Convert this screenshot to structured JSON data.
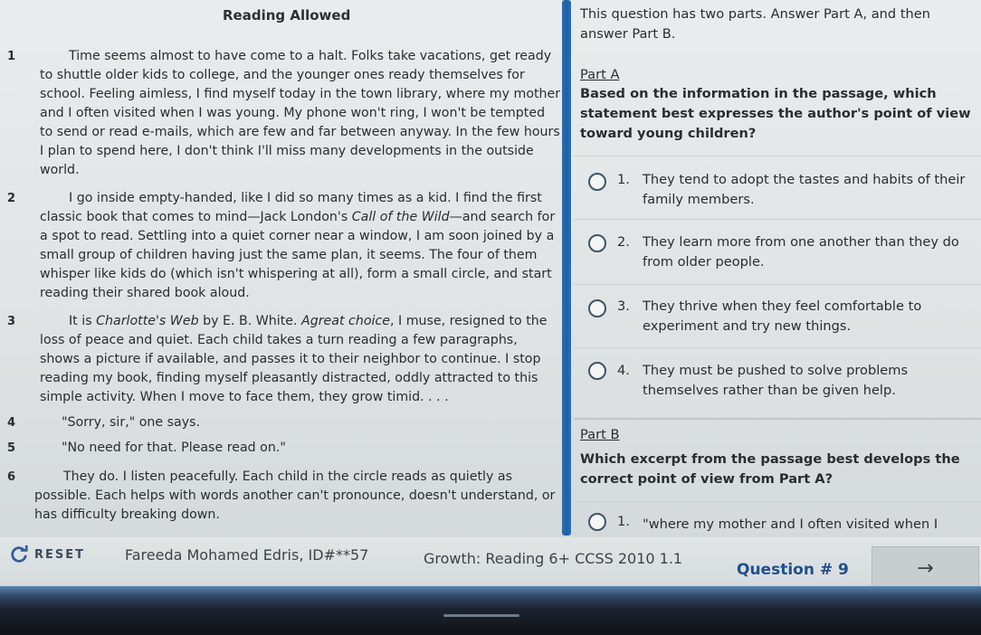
{
  "passage": {
    "title": "Reading Allowed",
    "paragraphs": [
      {
        "num": "1",
        "text": "Time seems almost to have come to a halt. Folks take vacations, get ready to shuttle older kids to college, and the younger ones ready themselves for school. Feeling aimless, I find myself today in the town library, where my mother and I often visited when I was young. My phone won't ring, I won't be tempted to send or read e-mails, which are few and far between anyway. In the few hours I plan to spend here, I don't think I'll miss many developments in the outside world."
      },
      {
        "num": "2",
        "text_a": "I go inside empty-handed, like I did so many times as a kid. I find the first classic book that comes to mind—Jack London's ",
        "em": "Call of the Wild",
        "text_b": "—and search for a spot to read. Settling into a quiet corner near a window, I am soon joined by a small group of children having just the same plan, it seems. The four of them whisper like kids do (which isn't whispering at all), form a small circle, and start reading their shared book aloud."
      },
      {
        "num": "3",
        "text_a": "It is ",
        "em": "Charlotte's Web",
        "text_b": " by E. B. White. ",
        "em2": "Agreat choice",
        "text_c": ", I muse, resigned to the loss of peace and quiet. Each child takes a turn reading a few paragraphs, shows a picture if available, and passes it to their neighbor to continue. I stop reading my book, finding myself pleasantly distracted, oddly attracted to this simple activity. When I move to face them, they grow timid. . . ."
      },
      {
        "num": "4",
        "text": "\"Sorry, sir,\" one says."
      },
      {
        "num": "5",
        "text": "\"No need for that. Please read on.\""
      },
      {
        "num": "6",
        "text": "They do. I listen peacefully. Each child in the circle reads as quietly as possible. Each helps with words another can't pronounce, doesn't understand, or has difficulty breaking down."
      }
    ]
  },
  "question": {
    "intro": "This question has two parts. Answer Part A, and then answer Part B.",
    "part_a": {
      "label": "Part A",
      "prompt": "Based on the information in the passage, which statement best expresses the author's point of view toward young children?",
      "options": [
        {
          "num": "1.",
          "text": "They tend to adopt the tastes and habits of their family members."
        },
        {
          "num": "2.",
          "text": "They learn more from one another than they do from older people."
        },
        {
          "num": "3.",
          "text": "They thrive when they feel comfortable to experiment and try new things."
        },
        {
          "num": "4.",
          "text": "They must be pushed to solve problems themselves rather than be given help."
        }
      ]
    },
    "part_b": {
      "label": "Part B",
      "prompt": "Which excerpt from the passage best develops the correct point of view from Part A?",
      "options": [
        {
          "num": "1.",
          "text": "\"where my mother and I often visited when I"
        }
      ]
    }
  },
  "status": {
    "reset_label": "RESET",
    "student": "Fareeda Mohamed Edris, ID#**57",
    "test": "Growth: Reading 6+ CCSS 2010 1.1",
    "question_number": "Question # 9",
    "next_symbol": "→"
  }
}
